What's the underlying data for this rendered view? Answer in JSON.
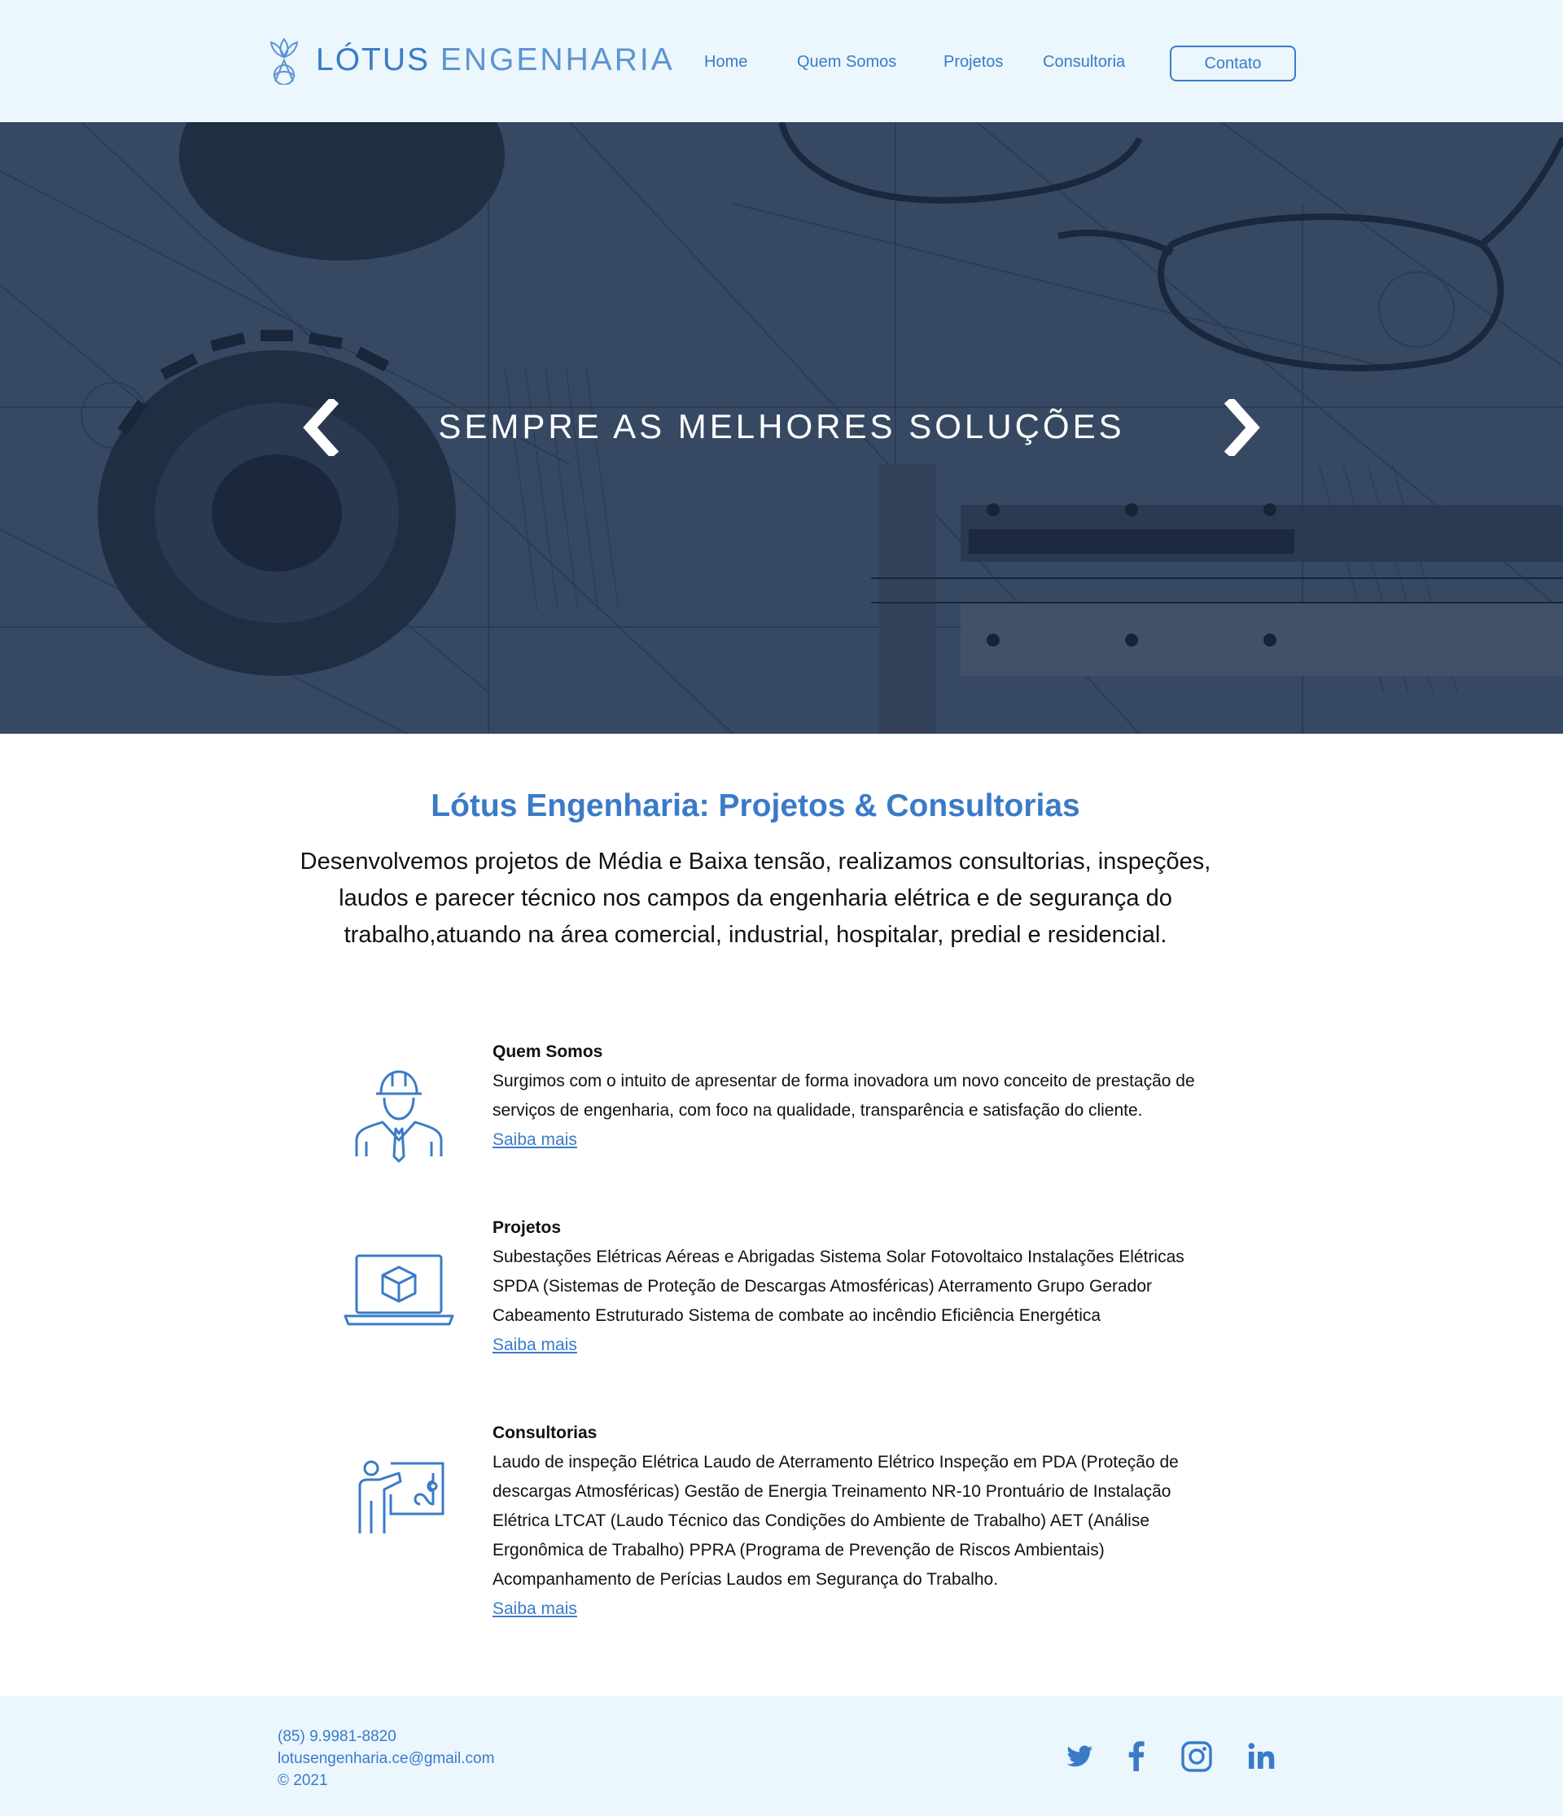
{
  "brand": {
    "name_strong": "LÓTUS",
    "name_light": "ENGENHARIA",
    "accent_color": "#3a7bc8"
  },
  "nav": {
    "items": [
      {
        "label": "Home"
      },
      {
        "label": "Quem Somos"
      },
      {
        "label": "Projetos"
      },
      {
        "label": "Consultoria"
      }
    ],
    "contact_label": "Contato"
  },
  "hero": {
    "title": "SEMPRE AS MELHORES SOLUÇÕES",
    "prev_icon": "chevron-left-icon",
    "next_icon": "chevron-right-icon"
  },
  "intro": {
    "title": "Lótus Engenharia: Projetos & Consultorias",
    "text": "Desenvolvemos projetos de Média e Baixa tensão, realizamos consultorias, inspeções, laudos e parecer técnico nos campos da engenharia elétrica e de segurança do trabalho,atuando na área comercial, industrial, hospitalar, predial e residencial."
  },
  "services": [
    {
      "title": "Quem Somos",
      "text": "Surgimos com o intuito de apresentar de forma inovadora um novo conceito de prestação de serviços de engenharia, com foco na qualidade, transparência e satisfação do cliente.",
      "link": "Saiba mais",
      "icon": "engineer-icon"
    },
    {
      "title": "Projetos",
      "text": "Subestações Elétricas Aéreas e Abrigadas Sistema Solar Fotovoltaico Instalações Elétricas SPDA (Sistemas de Proteção de Descargas Atmosféricas) Aterramento Grupo Gerador Cabeamento Estruturado Sistema de combate ao incêndio Eficiência Energética",
      "link": "Saiba mais",
      "icon": "laptop-cube-icon"
    },
    {
      "title": "Consultorias",
      "text": "Laudo de inspeção Elétrica Laudo de Aterramento Elétrico Inspeção em PDA (Proteção de descargas Atmosféricas) Gestão de Energia Treinamento NR-10 Prontuário de Instalação Elétrica LTCAT (Laudo Técnico das Condições do Ambiente de Trabalho) AET (Análise Ergonômica de Trabalho) PPRA (Programa de Prevenção de Riscos Ambientais) Acompanhamento de Perícias Laudos em Segurança do Trabalho.",
      "link": "Saiba mais",
      "icon": "presenter-board-icon"
    }
  ],
  "footer": {
    "phone": "(85) 9.9981-8820",
    "email": "lotusengenharia.ce@gmail.com",
    "copyright": "© 2021",
    "social": [
      "twitter-icon",
      "facebook-icon",
      "instagram-icon",
      "linkedin-icon"
    ]
  }
}
